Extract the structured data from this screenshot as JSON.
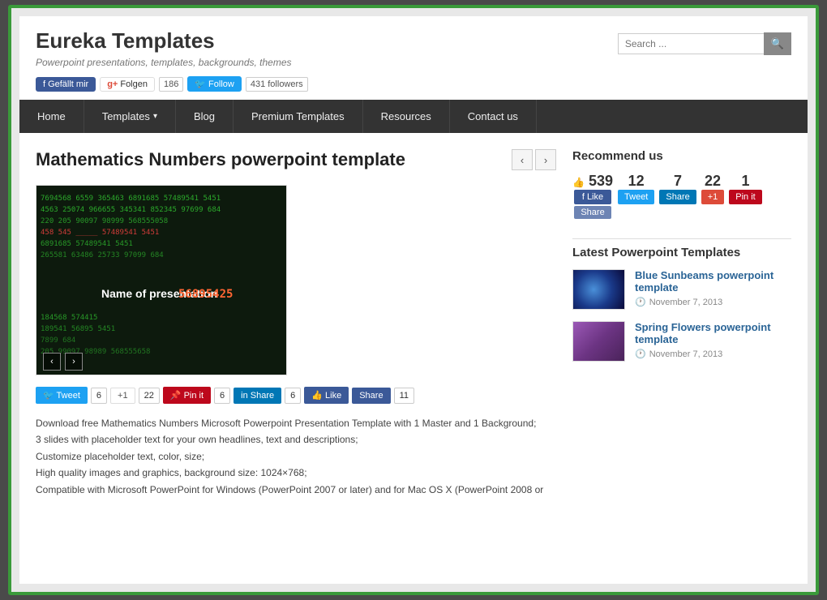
{
  "site": {
    "title": "Eureka Templates",
    "tagline": "Powerpoint presentations, templates, backgrounds, themes",
    "search_placeholder": "Search ..."
  },
  "social": {
    "fb_label": "Gefällt mir",
    "gplus_label": "Folgen",
    "gplus_count": "186",
    "twitter_label": "Follow",
    "twitter_count": "431 followers"
  },
  "nav": {
    "items": [
      {
        "label": "Home",
        "has_arrow": false
      },
      {
        "label": "Templates",
        "has_arrow": true
      },
      {
        "label": "Blog",
        "has_arrow": false
      },
      {
        "label": "Premium Templates",
        "has_arrow": false
      },
      {
        "label": "Resources",
        "has_arrow": false
      },
      {
        "label": "Contact us",
        "has_arrow": false
      }
    ]
  },
  "page": {
    "title": "Mathematics Numbers powerpoint template"
  },
  "slideshow": {
    "center_text": "Name of presentation",
    "number_overlay": "56895425"
  },
  "share_buttons": [
    {
      "type": "tweet",
      "label": "Tweet",
      "count": "6"
    },
    {
      "type": "gplus",
      "label": "+1",
      "count": "22"
    },
    {
      "type": "pin",
      "label": "Pin it",
      "count": "6"
    },
    {
      "type": "linkedin",
      "label": "Share",
      "count": "6"
    },
    {
      "type": "fblike",
      "label": "Like",
      "extra": "Share",
      "count": "11"
    }
  ],
  "description": {
    "line1": "Download free Mathematics Numbers Microsoft Powerpoint Presentation Template with 1 Master and 1 Background;",
    "line2": "3 slides with placeholder text for your own headlines, text and descriptions;",
    "line3": "Customize placeholder text, color, size;",
    "line4": "High quality images and graphics, background size: 1024×768;",
    "line5": "Compatible with Microsoft PowerPoint for Windows (PowerPoint 2007 or later) and for Mac OS X (PowerPoint 2008 or"
  },
  "sidebar": {
    "recommend_title": "Recommend us",
    "fb_count": "539",
    "fb_like_label": "Like",
    "fb_share_label": "Share",
    "twitter_count": "12",
    "twitter_label": "Tweet",
    "linkedin_count": "7",
    "linkedin_label": "Share",
    "gplus_count": "22",
    "gplus_label": "+1",
    "pin_count": "1",
    "pin_label": "Pin it",
    "latest_title": "Latest Powerpoint Templates",
    "latest_items": [
      {
        "title": "Blue Sunbeams powerpoint template",
        "date": "November 7, 2013",
        "thumb": "blue"
      },
      {
        "title": "Spring Flowers powerpoint template",
        "date": "November 7, 2013",
        "thumb": "purple"
      }
    ]
  }
}
